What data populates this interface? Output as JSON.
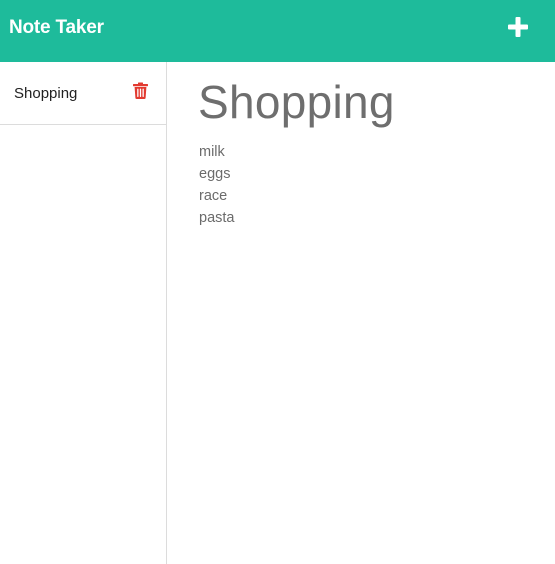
{
  "app": {
    "title": "Note Taker",
    "accent_color": "#1ebb9b",
    "delete_color": "#e23a30"
  },
  "toolbar": {
    "add_icon": "plus-icon"
  },
  "sidebar": {
    "items": [
      {
        "label": "Shopping",
        "icon": "trash-icon"
      }
    ]
  },
  "note": {
    "title": "Shopping",
    "lines": [
      "milk",
      "eggs",
      "race",
      "pasta"
    ]
  }
}
